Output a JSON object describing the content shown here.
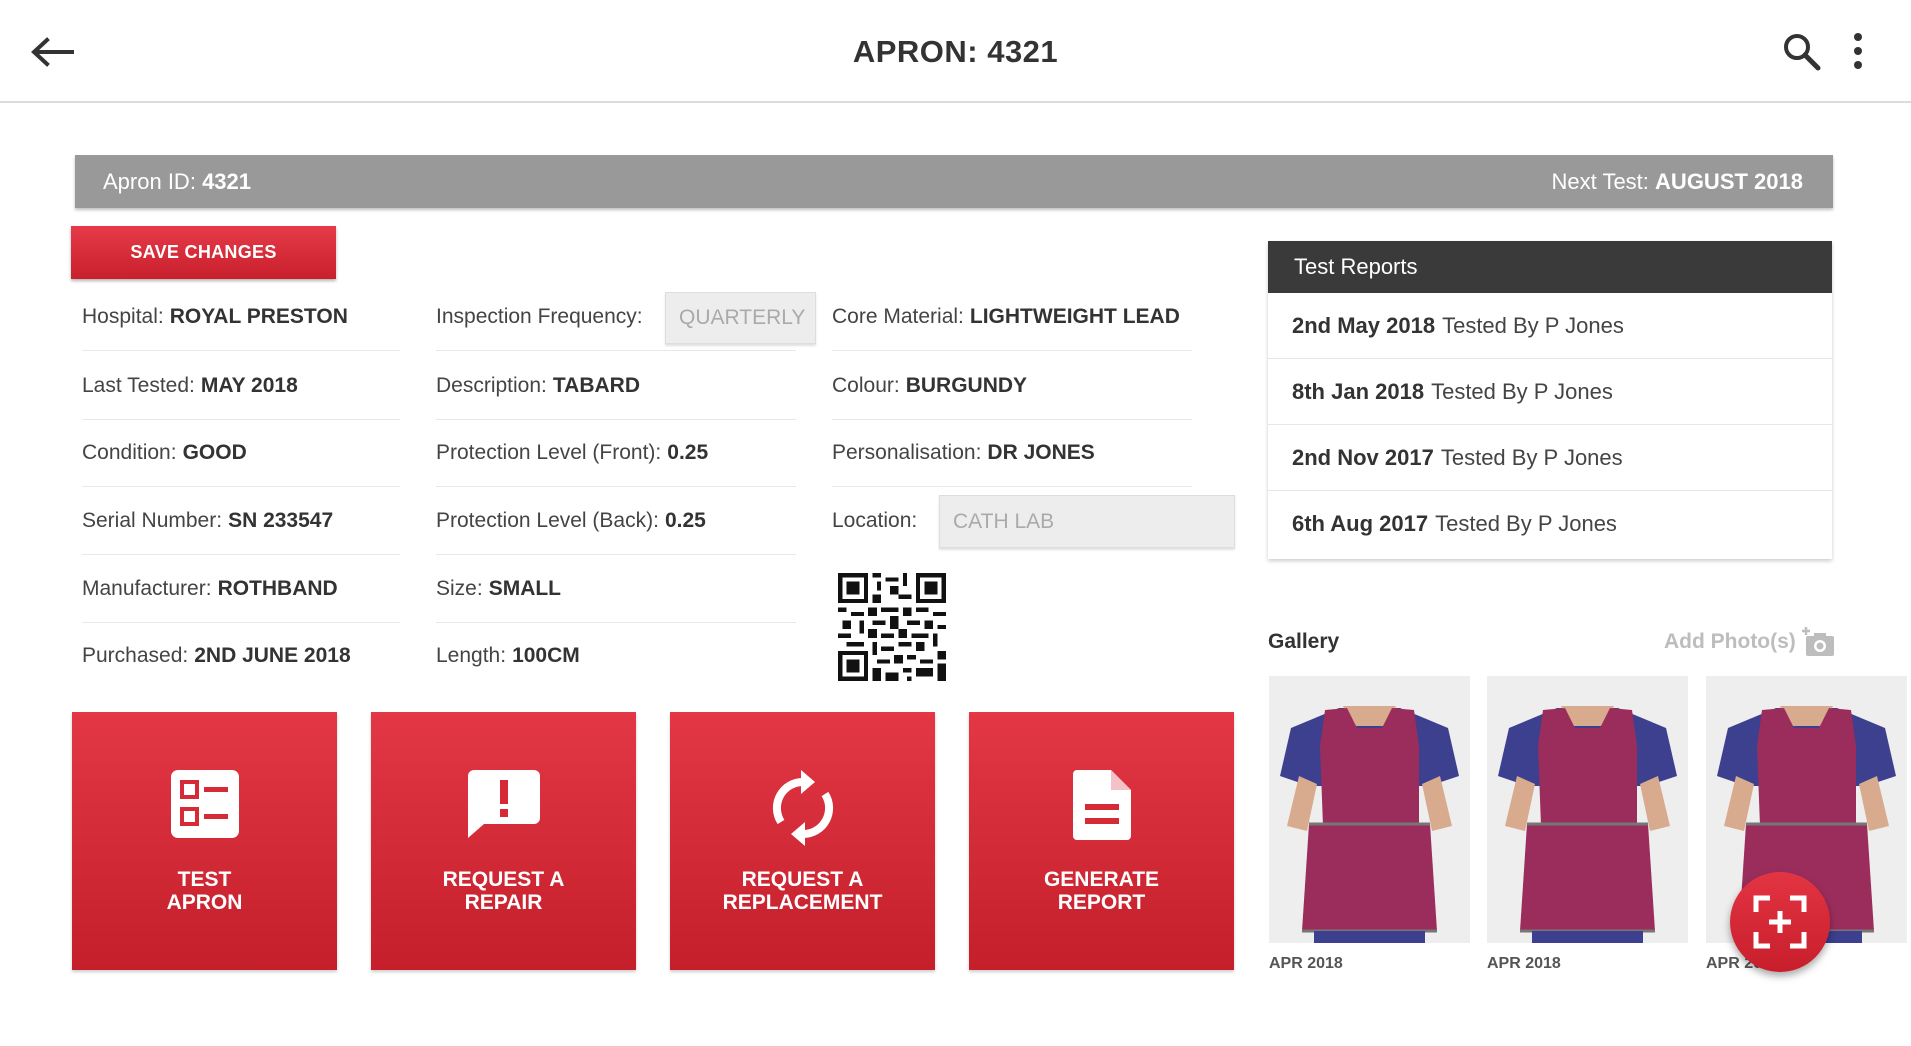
{
  "header": {
    "title": "APRON: 4321"
  },
  "info_bar": {
    "id_label": "Apron ID:",
    "id_value": "4321",
    "next_test_label": "Next Test:",
    "next_test_value": "AUGUST 2018"
  },
  "save_label": "SAVE CHANGES",
  "fields": {
    "hospital": {
      "label": "Hospital:",
      "value": "ROYAL PRESTON"
    },
    "last_tested": {
      "label": "Last Tested:",
      "value": "MAY 2018"
    },
    "condition": {
      "label": "Condition:",
      "value": "GOOD"
    },
    "serial": {
      "label": "Serial Number:",
      "value": "SN 233547"
    },
    "manufacturer": {
      "label": "Manufacturer:",
      "value": "ROTHBAND"
    },
    "purchased": {
      "label": "Purchased:",
      "value": "2ND JUNE 2018"
    },
    "inspection_frequency": {
      "label": "Inspection Frequency:",
      "value": "QUARTERLY"
    },
    "description": {
      "label": "Description:",
      "value": "TABARD"
    },
    "protection_front": {
      "label": "Protection Level (Front):",
      "value": "0.25"
    },
    "protection_back": {
      "label": "Protection Level (Back):",
      "value": "0.25"
    },
    "size": {
      "label": "Size:",
      "value": "SMALL"
    },
    "length": {
      "label": "Length:",
      "value": "100CM"
    },
    "core_material": {
      "label": "Core Material:",
      "value": "LIGHTWEIGHT LEAD"
    },
    "colour": {
      "label": "Colour:",
      "value": "BURGUNDY"
    },
    "personalisation": {
      "label": "Personalisation:",
      "value": "DR JONES"
    },
    "location": {
      "label": "Location:",
      "value": "CATH LAB"
    }
  },
  "actions": [
    {
      "label": "TEST\nAPRON",
      "icon": "checklist-icon"
    },
    {
      "label": "REQUEST A\nREPAIR",
      "icon": "alert-message-icon"
    },
    {
      "label": "REQUEST A\nREPLACEMENT",
      "icon": "refresh-icon"
    },
    {
      "label": "GENERATE\nREPORT",
      "icon": "document-icon"
    }
  ],
  "test_reports": {
    "title": "Test Reports",
    "items": [
      {
        "date": "2nd May 2018",
        "text": "Tested By P Jones"
      },
      {
        "date": "8th Jan 2018",
        "text": "Tested By P Jones"
      },
      {
        "date": "2nd Nov 2017",
        "text": "Tested By P Jones"
      },
      {
        "date": "6th Aug 2017",
        "text": "Tested By P Jones"
      }
    ]
  },
  "gallery": {
    "title": "Gallery",
    "add_label": "Add Photo(s)",
    "photos": [
      {
        "date": "APR 2018"
      },
      {
        "date": "APR 2018"
      },
      {
        "date": "APR 20"
      }
    ]
  },
  "colors": {
    "accent": "#d62a37",
    "info_bar": "#999999",
    "reports_header": "#3a3a3a",
    "apron": "#9b2d5c"
  }
}
